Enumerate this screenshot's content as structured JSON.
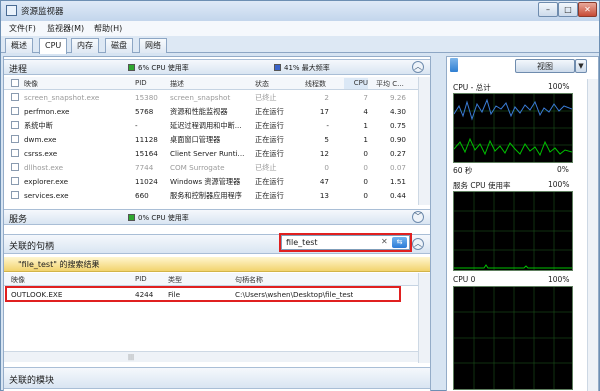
{
  "window": {
    "title": "资源监视器",
    "btn_min": "–",
    "btn_max": "□",
    "btn_close": "✕"
  },
  "menu": [
    "文件(F)",
    "监视器(M)",
    "帮助(H)"
  ],
  "tabs": [
    "概述",
    "CPU",
    "内存",
    "磁盘",
    "网络"
  ],
  "process": {
    "title": "进程",
    "cpu_usage": "6% CPU 使用率",
    "max_freq": "41% 最大频率",
    "columns": [
      "映像",
      "PID",
      "描述",
      "状态",
      "线程数",
      "CPU",
      "平均 C..."
    ],
    "rows": [
      [
        "screen_snapshot.exe",
        "15380",
        "screen_snapshot",
        "已终止",
        "2",
        "7",
        "9.26"
      ],
      [
        "perfmon.exe",
        "5768",
        "资源和性能监视器",
        "正在运行",
        "17",
        "4",
        "4.30"
      ],
      [
        "系统中断",
        "-",
        "延迟过程调用和中断...",
        "正在运行",
        "-",
        "1",
        "0.75"
      ],
      [
        "dwm.exe",
        "11128",
        "桌面窗口管理器",
        "正在运行",
        "5",
        "1",
        "0.90"
      ],
      [
        "csrss.exe",
        "15164",
        "Client Server Runti...",
        "正在运行",
        "12",
        "0",
        "0.27"
      ],
      [
        "dllhost.exe",
        "7744",
        "COM Surrogate",
        "已终止",
        "0",
        "0",
        "0.07"
      ],
      [
        "explorer.exe",
        "11024",
        "Windows 资源管理器",
        "正在运行",
        "47",
        "0",
        "1.51"
      ],
      [
        "services.exe",
        "660",
        "服务和控制器应用程序",
        "正在运行",
        "13",
        "0",
        "0.44"
      ]
    ],
    "gray_rows": [
      0,
      5
    ]
  },
  "services": {
    "title": "服务",
    "cpu_usage": "0% CPU 使用率"
  },
  "handles": {
    "title": "关联的句柄",
    "search_value": "file_test",
    "search_clear": "✕",
    "banner": "\"file_test\" 的搜索结果",
    "columns": [
      "映像",
      "PID",
      "类型",
      "句柄名称"
    ],
    "rows": [
      [
        "OUTLOOK.EXE",
        "4244",
        "File",
        "C:\\Users\\wshen\\Desktop\\file_test"
      ]
    ]
  },
  "modules": {
    "title": "关联的模块"
  },
  "right_panel": {
    "view_label": "视图",
    "cpu_total": {
      "label": "CPU - 总计",
      "max": "100%",
      "time": "60 秒",
      "min": "0%"
    },
    "service_cpu": {
      "label": "服务 CPU 使用率",
      "max": "100%"
    },
    "cpu0": {
      "label": "CPU 0",
      "max": "100%"
    }
  },
  "colors": {
    "accent_red": "#e02020",
    "graph_bg": "#000000",
    "graph_green": "#00c000",
    "graph_blue": "#3a7bd5"
  }
}
